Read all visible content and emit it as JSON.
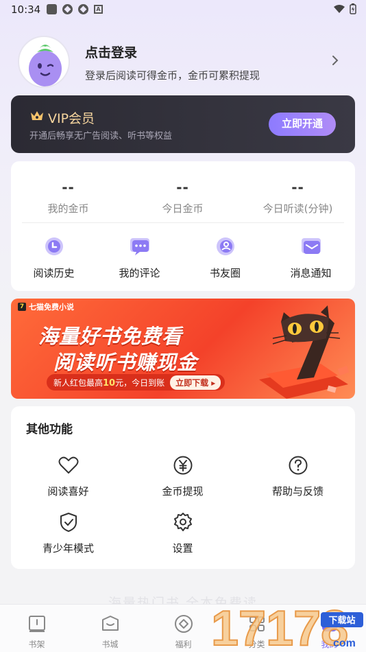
{
  "status_bar": {
    "time": "10:34",
    "icons": [
      "square-notification-icon",
      "app-notification-icon",
      "app-notification-icon",
      "a-notification-icon",
      "wifi-icon",
      "battery-icon"
    ]
  },
  "profile": {
    "title": "点击登录",
    "subtitle": "登录后阅读可得金币，金币可累积提现"
  },
  "vip": {
    "title": "VIP会员",
    "subtitle": "开通后畅享无广告阅读、听书等权益",
    "button": "立即开通",
    "accent": "#f6d59e"
  },
  "stats": [
    {
      "value": "--",
      "label": "我的金币"
    },
    {
      "value": "--",
      "label": "今日金币"
    },
    {
      "value": "--",
      "label": "今日听读(分钟)"
    }
  ],
  "quick_actions": [
    {
      "label": "阅读历史",
      "icon": "history-icon"
    },
    {
      "label": "我的评论",
      "icon": "comment-icon"
    },
    {
      "label": "书友圈",
      "icon": "circle-icon"
    },
    {
      "label": "消息通知",
      "icon": "message-icon"
    }
  ],
  "banner": {
    "brand": "七猫免费小说",
    "line1": "海量好书免费看",
    "line2": "阅读听书赚现金",
    "pill_prefix": "新人红包最高",
    "pill_amount": "10",
    "pill_suffix": "元，今日到账",
    "cta": "立即下载 ▸"
  },
  "other_functions": {
    "title": "其他功能",
    "items": [
      {
        "label": "阅读喜好",
        "icon": "heart-icon"
      },
      {
        "label": "金币提现",
        "icon": "yen-icon"
      },
      {
        "label": "帮助与反馈",
        "icon": "help-icon"
      },
      {
        "label": "青少年模式",
        "icon": "shield-check-icon"
      },
      {
        "label": "设置",
        "icon": "gear-icon"
      }
    ]
  },
  "footer_text": "海量热门书 全本免费读",
  "bottom_nav": [
    {
      "label": "书架",
      "icon": "bookshelf-icon"
    },
    {
      "label": "书城",
      "icon": "bookstore-icon"
    },
    {
      "label": "福利",
      "icon": "welfare-icon"
    },
    {
      "label": "分类",
      "icon": "category-icon"
    },
    {
      "label": "我的",
      "icon": "profile-icon",
      "active": true
    }
  ],
  "watermark": {
    "text": "17178",
    "badge": "下载站",
    "domain": "com"
  },
  "colors": {
    "brand_purple": "#7d6cf2",
    "vip_card": "#2b2a33",
    "banner_red": "#f4422a"
  }
}
